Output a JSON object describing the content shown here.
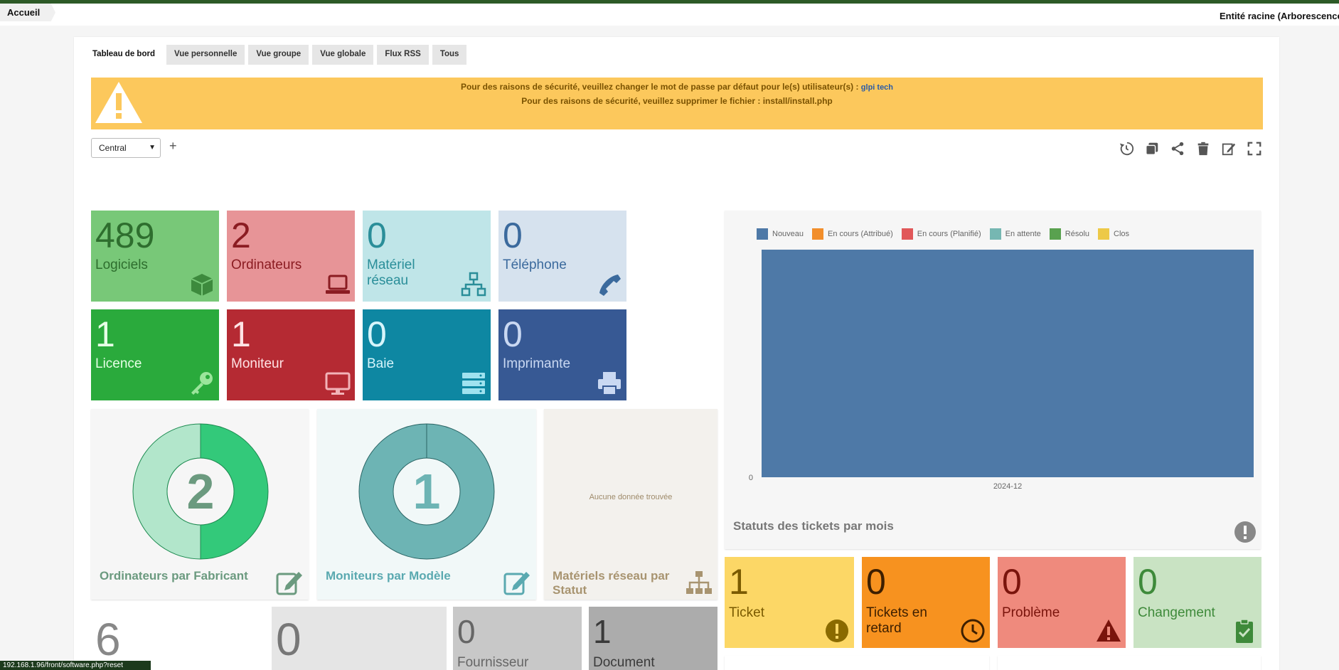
{
  "header": {
    "breadcrumb": "Accueil",
    "entity": "Entité racine (Arborescence)"
  },
  "tabs": [
    {
      "label": "Tableau de bord"
    },
    {
      "label": "Vue personnelle"
    },
    {
      "label": "Vue groupe"
    },
    {
      "label": "Vue globale"
    },
    {
      "label": "Flux RSS"
    },
    {
      "label": "Tous"
    }
  ],
  "warning": {
    "line1": "Pour des raisons de sécurité, veuillez changer le mot de passe par défaut pour le(s) utilisateur(s) :",
    "line1_link": "glpi tech",
    "line2": "Pour des raisons de sécurité, veuillez supprimer le fichier : install/install.php"
  },
  "dashboard_select": {
    "value": "Central"
  },
  "cards": {
    "logiciels": {
      "value": "489",
      "label": "Logiciels"
    },
    "ordinateurs": {
      "value": "2",
      "label": "Ordinateurs"
    },
    "materiel_reseau": {
      "value": "0",
      "label": "Matériel réseau"
    },
    "telephone": {
      "value": "0",
      "label": "Téléphone"
    },
    "licence": {
      "value": "1",
      "label": "Licence"
    },
    "moniteur": {
      "value": "1",
      "label": "Moniteur"
    },
    "baie": {
      "value": "0",
      "label": "Baie"
    },
    "imprimante": {
      "value": "0",
      "label": "Imprimante"
    },
    "ticket": {
      "value": "1",
      "label": "Ticket"
    },
    "tickets_retard": {
      "value": "0",
      "label": "Tickets en retard"
    },
    "probleme": {
      "value": "0",
      "label": "Problème"
    },
    "changement": {
      "value": "0",
      "label": "Changement"
    },
    "bottom1": {
      "value": "6"
    },
    "bottom2": {
      "value": "0"
    },
    "fournisseur": {
      "value": "0",
      "label": "Fournisseur"
    },
    "document": {
      "value": "1",
      "label": "Document"
    }
  },
  "donuts": {
    "ordinateurs": {
      "total": "2",
      "title": "Ordinateurs par Fabricant",
      "segments": [
        0.5,
        0.5
      ]
    },
    "moniteurs": {
      "total": "1",
      "title": "Moniteurs par Modèle",
      "segments": [
        1.0
      ]
    },
    "reseau": {
      "title": "Matériels réseau par Statut",
      "empty": "Aucune donnée trouvée"
    }
  },
  "chart_data": {
    "type": "bar",
    "title": "Statuts des tickets par mois",
    "categories": [
      "2024-12"
    ],
    "yticks": [
      "0"
    ],
    "series": [
      {
        "name": "Nouveau",
        "color": "#4e79a7",
        "values": [
          1
        ]
      },
      {
        "name": "En cours (Attribué)",
        "color": "#f28e2b",
        "values": [
          0
        ]
      },
      {
        "name": "En cours (Planifié)",
        "color": "#e15759",
        "values": [
          0
        ]
      },
      {
        "name": "En attente",
        "color": "#76b7b2",
        "values": [
          0
        ]
      },
      {
        "name": "Résolu",
        "color": "#59a14f",
        "values": [
          0
        ]
      },
      {
        "name": "Clos",
        "color": "#edc948",
        "values": [
          0
        ]
      }
    ],
    "legend": "top"
  },
  "statusbar": {
    "url": "192.168.1.96/front/software.php?reset"
  }
}
